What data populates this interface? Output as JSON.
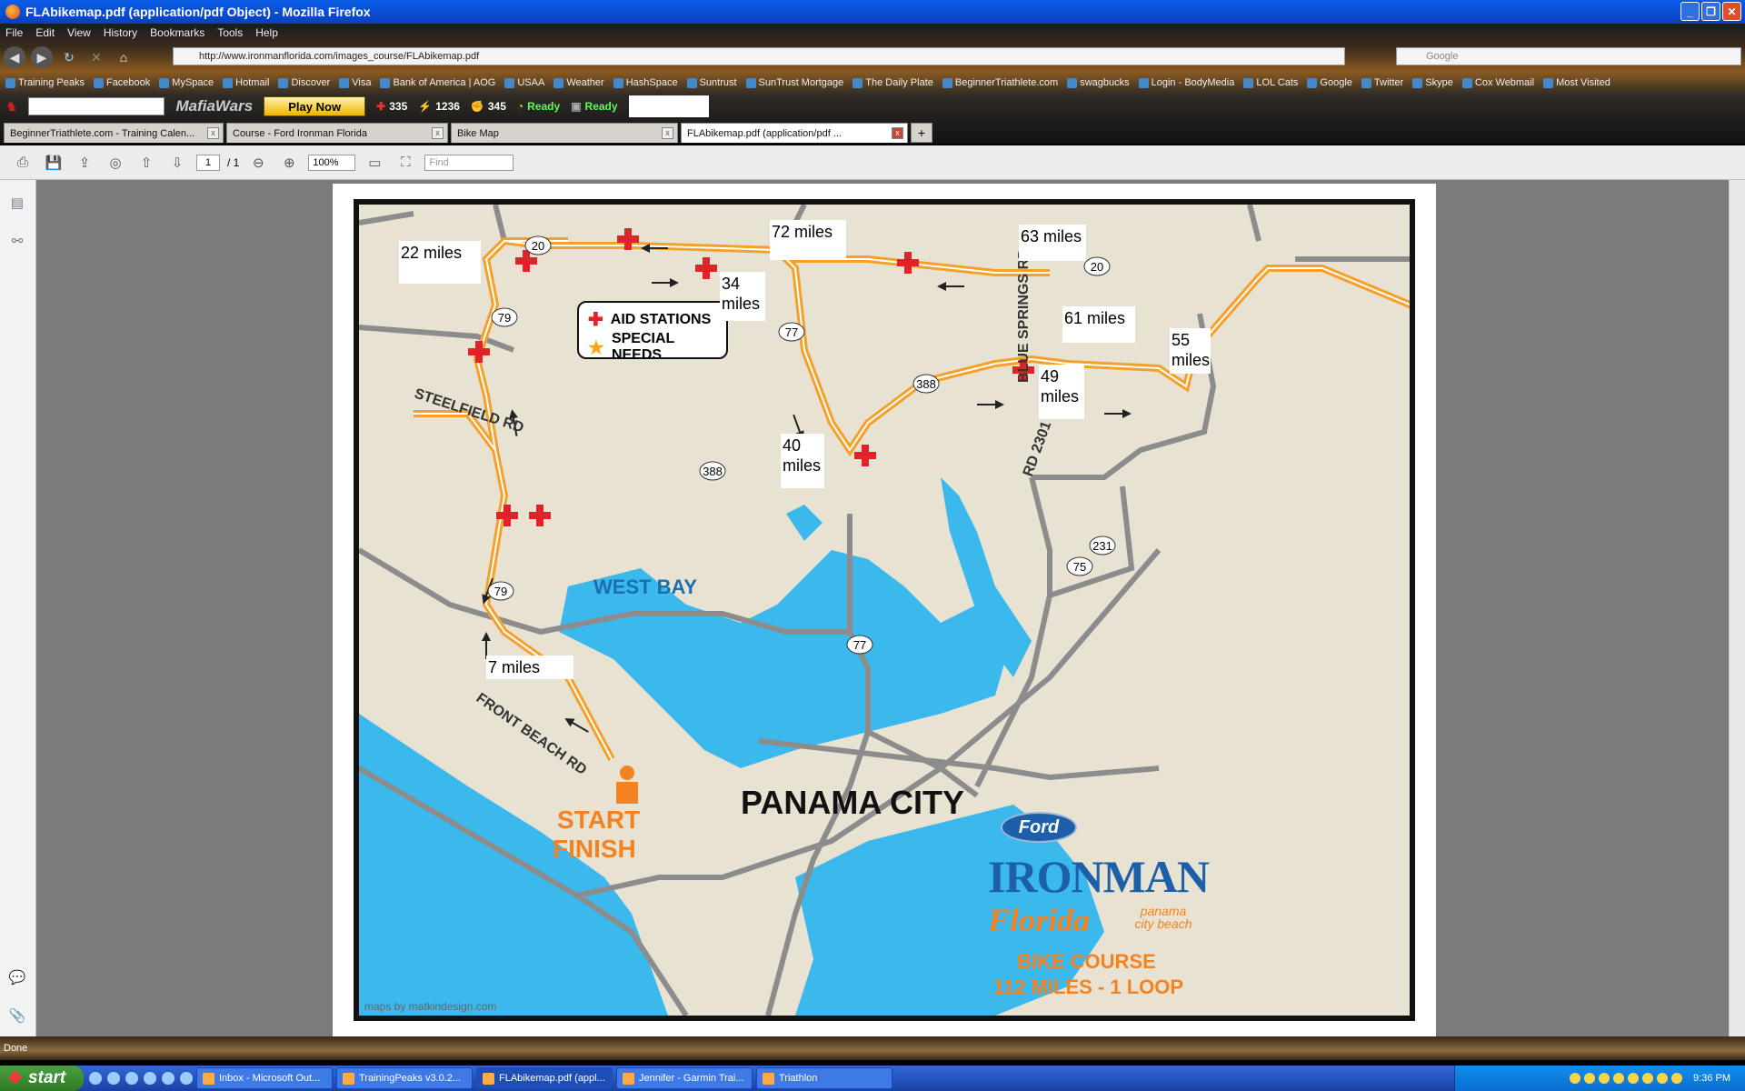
{
  "window": {
    "title": "FLAbikemap.pdf (application/pdf Object) - Mozilla Firefox"
  },
  "menu": [
    "File",
    "Edit",
    "View",
    "History",
    "Bookmarks",
    "Tools",
    "Help"
  ],
  "nav": {
    "url": "http://www.ironmanflorida.com/images_course/FLAbikemap.pdf",
    "search_placeholder": "Google"
  },
  "bookmarks": [
    "Training Peaks",
    "Facebook",
    "MySpace",
    "Hotmail",
    "Discover",
    "Visa",
    "Bank of America | AOG",
    "USAA",
    "Weather",
    "HashSpace",
    "Suntrust",
    "SunTrust Mortgage",
    "The Daily Plate",
    "BeginnerTriathlete.com",
    "swagbucks",
    "Login - BodyMedia",
    "LOL Cats",
    "Google",
    "Twitter",
    "Skype",
    "Cox Webmail",
    "Most Visited"
  ],
  "toolbar2": {
    "logo": "MafiaWars",
    "play_now": "Play Now",
    "health": "335",
    "energy": "1236",
    "stamina": "345",
    "ready1": "Ready",
    "ready2": "Ready"
  },
  "tabs": [
    "BeginnerTriathlete.com - Training Calen...",
    "Course - Ford Ironman Florida",
    "Bike Map",
    "FLAbikemap.pdf (application/pdf ..."
  ],
  "pdf": {
    "page": "1",
    "page_total": "/ 1",
    "zoom": "100%",
    "find_placeholder": "Find"
  },
  "map": {
    "mile_labels": [
      "22 miles",
      "72 miles",
      "63 miles",
      "34 miles",
      "61 miles",
      "55 miles",
      "49 miles",
      "40 miles",
      "7 miles"
    ],
    "legend": {
      "aid": "AID STATIONS",
      "special": "SPECIAL NEEDS"
    },
    "place_labels": {
      "west_bay": "WEST BAY",
      "panama_city": "PANAMA CITY",
      "steelfield": "STEELFIELD RD",
      "front_beach": "FRONT BEACH RD",
      "blue_springs": "BLUE SPRINGS RD",
      "rd2301": "RD 2301",
      "start": "START",
      "finish": "FINISH",
      "credit": "maps by matkindesign.com"
    },
    "route_shields": [
      "20",
      "79",
      "77",
      "20",
      "388",
      "388",
      "79",
      "77",
      "231",
      "75"
    ],
    "brand": {
      "ford": "Ford",
      "ironman": "IRONMAN",
      "florida": "Florida",
      "panama": "panama city beach",
      "bike_course": "BIKE COURSE",
      "distance": "112 MILES - 1 LOOP"
    },
    "colors": {
      "route": "#f5a02a",
      "water": "#3cb9ec",
      "land": "#e8e2d3",
      "road": "#8c8c8c",
      "aid": "#e12228",
      "brand_blue": "#1d5fa8",
      "brand_orange": "#f58220"
    }
  },
  "status": "Done",
  "taskbar": {
    "start": "start",
    "tasks": [
      "Inbox - Microsoft Out...",
      "TrainingPeaks v3.0.2...",
      "FLAbikemap.pdf (appl...",
      "Jennifer - Garmin Trai...",
      "Triathlon"
    ],
    "clock": "9:36 PM"
  }
}
